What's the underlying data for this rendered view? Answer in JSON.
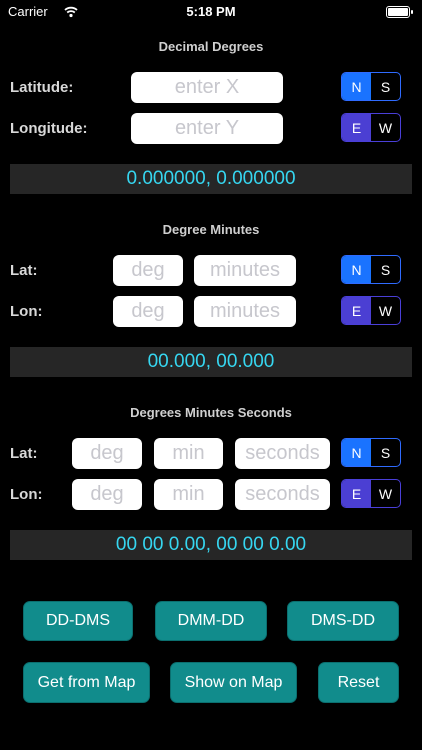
{
  "status_bar": {
    "carrier": "Carrier",
    "time": "5:18 PM"
  },
  "dd": {
    "title": "Decimal Degrees",
    "lat_label": "Latitude:",
    "lon_label": "Longitude:",
    "lat_placeholder": "enter X",
    "lon_placeholder": "enter Y",
    "result": "0.000000, 0.000000"
  },
  "dmm": {
    "title": "Degree Minutes",
    "lat_label": "Lat:",
    "lon_label": "Lon:",
    "deg_placeholder": "deg",
    "min_placeholder": "minutes",
    "result": "00.000, 00.000"
  },
  "dms": {
    "title": "Degrees Minutes Seconds",
    "lat_label": "Lat:",
    "lon_label": "Lon:",
    "deg_placeholder": "deg",
    "min_placeholder": "min",
    "sec_placeholder": "seconds",
    "result": "00 00 0.00, 00 00 0.00"
  },
  "segments": {
    "ns": {
      "a": "N",
      "b": "S",
      "selected": "N"
    },
    "ew": {
      "a": "E",
      "b": "W",
      "selected": "E"
    }
  },
  "buttons": {
    "dd_dms": "DD-DMS",
    "dmm_dd": "DMM-DD",
    "dms_dd": "DMS-DD",
    "get_from_map": "Get from Map",
    "show_on_map": "Show on Map",
    "reset": "Reset"
  },
  "colors": {
    "accent_teal": "#118c8c",
    "result_text": "#36d6f0",
    "segment_blue": "#1a73ff",
    "segment_purple": "#4b3fd3"
  }
}
